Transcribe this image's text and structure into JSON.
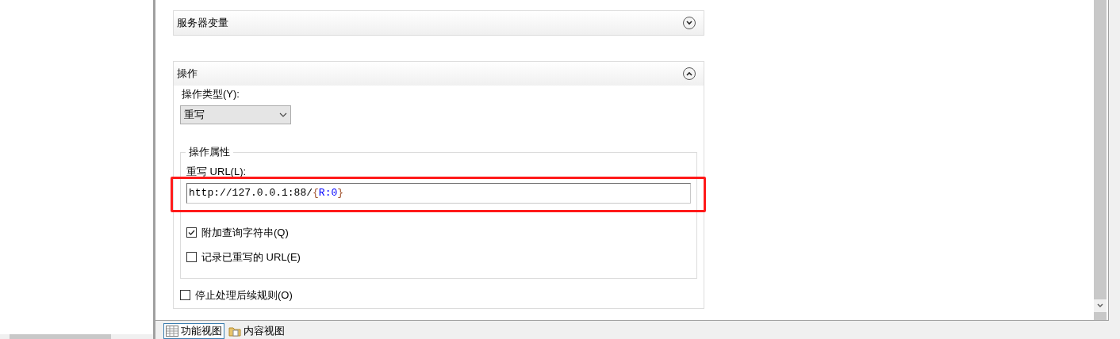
{
  "sections": [
    {
      "title": "服务器变量",
      "expanded": false
    },
    {
      "title": "操作",
      "expanded": true,
      "action_type": {
        "label": "操作类型(Y):",
        "value": "重写"
      },
      "properties": {
        "legend": "操作属性",
        "url_label": "重写 URL(L):",
        "url_parts": [
          {
            "text": "http://127.0.0.1:88/",
            "color": "#000000"
          },
          {
            "text": "{",
            "color": "#a0522d"
          },
          {
            "text": "R:0",
            "color": "#0000ff"
          },
          {
            "text": "}",
            "color": "#a0522d"
          }
        ],
        "options": [
          {
            "label": "附加查询字符串(Q)",
            "checked": true
          },
          {
            "label": "记录已重写的 URL(E)",
            "checked": false
          }
        ]
      },
      "stop_processing": {
        "label": "停止处理后续规则(O)",
        "checked": false
      }
    }
  ],
  "bottom_tabs": [
    {
      "label": "功能视图",
      "selected": true
    },
    {
      "label": "内容视图",
      "selected": false
    }
  ]
}
